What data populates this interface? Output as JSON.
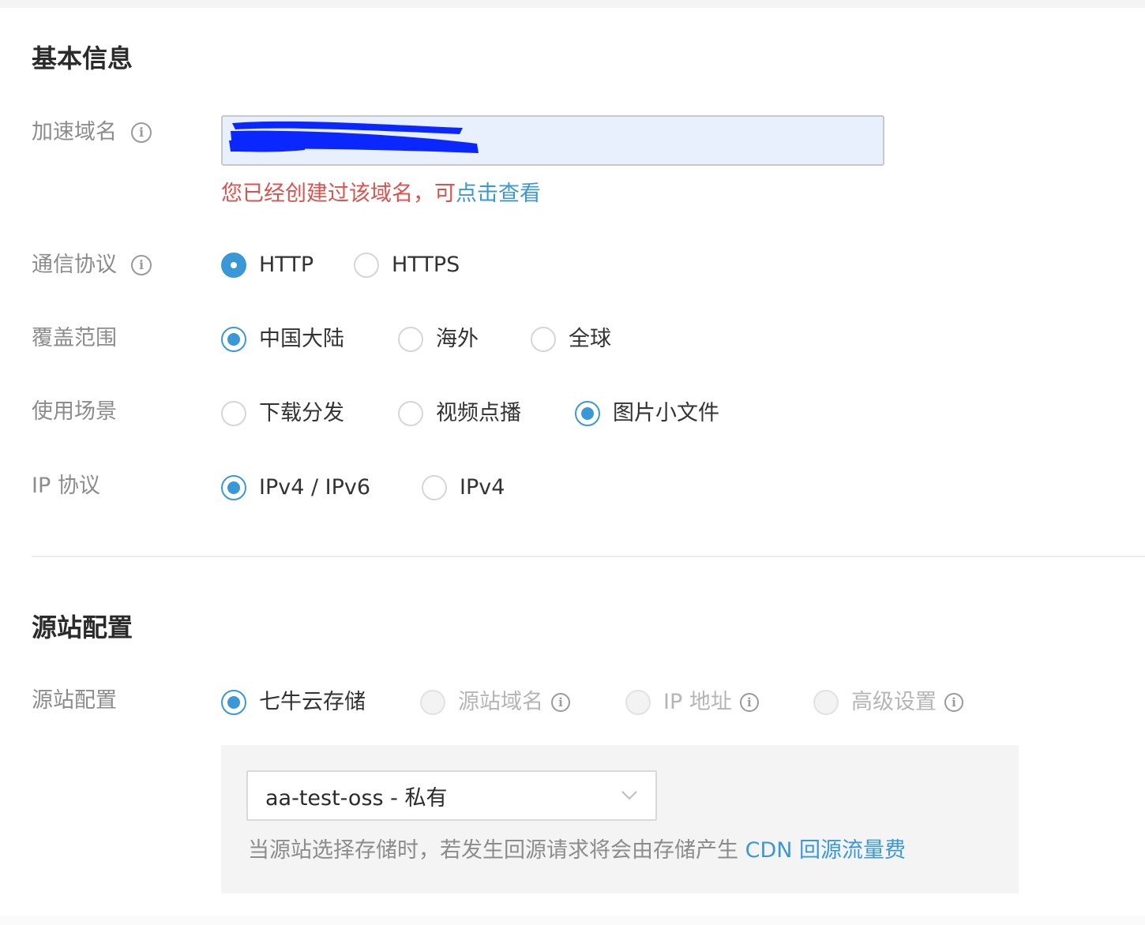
{
  "basic": {
    "title": "基本信息",
    "domain": {
      "label": "加速域名",
      "value": "",
      "error_text": "您已经创建过该域名，可",
      "error_link": "点击查看"
    },
    "protocol": {
      "label": "通信协议",
      "options": [
        "HTTP",
        "HTTPS"
      ],
      "selected": "HTTP"
    },
    "coverage": {
      "label": "覆盖范围",
      "options": [
        "中国大陆",
        "海外",
        "全球"
      ],
      "selected": "中国大陆"
    },
    "scenario": {
      "label": "使用场景",
      "options": [
        "下载分发",
        "视频点播",
        "图片小文件"
      ],
      "selected": "图片小文件"
    },
    "ip_protocol": {
      "label": "IP 协议",
      "options": [
        "IPv4 / IPv6",
        "IPv4"
      ],
      "selected": "IPv4 / IPv6"
    }
  },
  "origin": {
    "title": "源站配置",
    "label": "源站配置",
    "options": [
      "七牛云存储",
      "源站域名",
      "IP 地址",
      "高级设置"
    ],
    "selected": "七牛云存储",
    "bucket_value": "aa-test-oss - 私有",
    "note_text": "当源站选择存储时，若发生回源请求将会由存储产生 ",
    "note_link": "CDN 回源流量费"
  },
  "colors": {
    "accent": "#3b98d6",
    "error": "#d9534f",
    "redaction": "#0a27ff"
  },
  "icons": {
    "info": "info-icon",
    "dropdown": "chevron-down-icon"
  }
}
